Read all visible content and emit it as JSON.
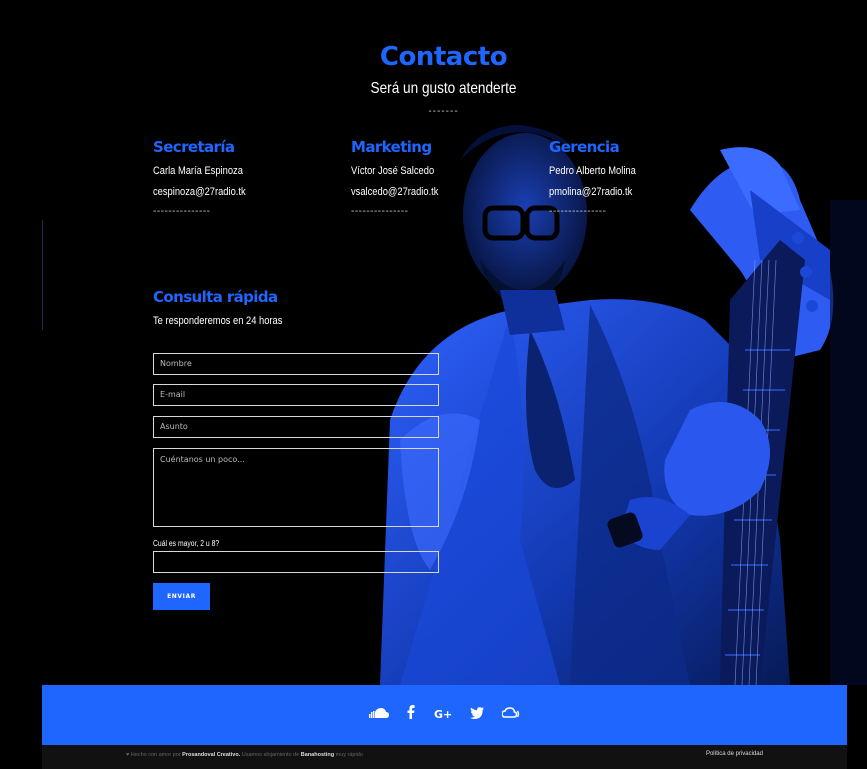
{
  "header": {
    "title": "Contacto",
    "subtitle": "Será un gusto atenderte",
    "separator": "-------"
  },
  "contacts": [
    {
      "title": "Secretaría",
      "name": "Carla María Espinoza",
      "email": "cespinoza@27radio.tk",
      "dash": "---------------"
    },
    {
      "title": "Marketing",
      "name": "Víctor José Salcedo",
      "email": "vsalcedo@27radio.tk",
      "dash": "---------------"
    },
    {
      "title": "Gerencia",
      "name": "Pedro Alberto Molina",
      "email": "pmolina@27radio.tk",
      "dash": "---------------"
    }
  ],
  "form": {
    "title": "Consulta rápida",
    "subtitle": "Te responderemos en 24 horas",
    "name_placeholder": "Nombre",
    "email_placeholder": "E-mail",
    "subject_placeholder": "Asunto",
    "message_placeholder": "Cuéntanos un poco...",
    "captcha_label": "Cuál es mayor, 2 u 8?",
    "captcha_value": "",
    "submit_label": "ENVIAR"
  },
  "footer": {
    "social_icons": [
      "soundcloud-icon",
      "facebook-icon",
      "google-plus-icon",
      "twitter-icon",
      "mixcloud-icon"
    ],
    "credits_prefix": "♥ Hecho con amor por",
    "credits_author": "Prosandoval Creativo.",
    "credits_middle": "Usamos alojamiento de",
    "credits_host": "Banahosting",
    "credits_suffix": "muy rápido",
    "privacy_label": "Política de privacidad"
  },
  "colors": {
    "accent": "#1f66ff",
    "background": "#000000",
    "bottom_bar": "#111111"
  }
}
